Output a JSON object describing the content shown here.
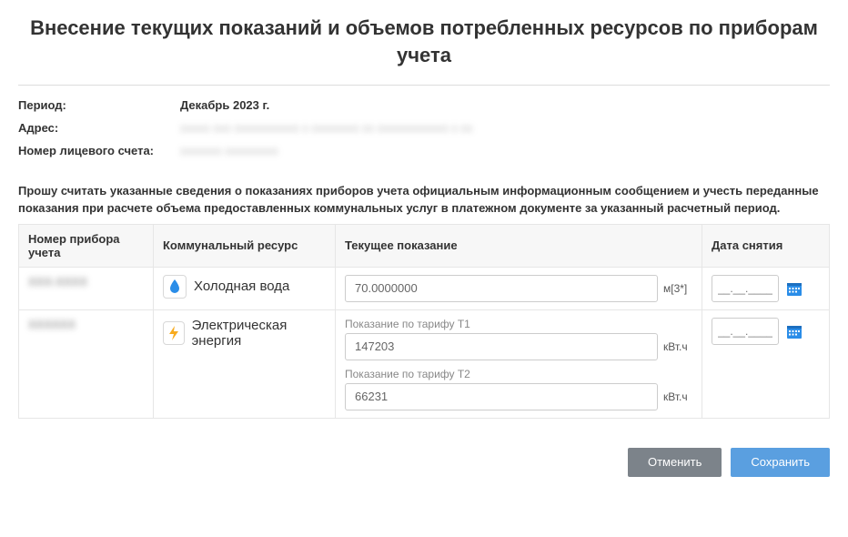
{
  "title": "Внесение текущих показаний и объемов потребленных ресурсов по приборам учета",
  "info": {
    "period_label": "Период:",
    "period_value": "Декабрь 2023 г.",
    "address_label": "Адрес:",
    "address_value": "xxxxx xxx xxxxxxxxxxx x xxxxxxxx xx xxxxxxxxxxxx x xx",
    "account_label": "Номер лицевого счета:",
    "account_value": "xxxxxxx xxxxxxxxx"
  },
  "notice": "Прошу считать указанные сведения о показаниях приборов учета официальным информационным сообщением и учесть переданные показания при расчете объема предоставленных коммунальных услуг в платежном документе за указанный расчетный период.",
  "table": {
    "headers": {
      "meter": "Номер прибора учета",
      "resource": "Коммунальный ресурс",
      "reading": "Текущее показание",
      "date": "Дата снятия"
    },
    "rows": [
      {
        "meter_num": "XXX-XXXX",
        "resource": "Холодная вода",
        "icon": "water-drop-icon",
        "readings": [
          {
            "label": "",
            "value": "70.0000000",
            "unit": "м[3*]"
          }
        ],
        "date_placeholder": "__.__.____"
      },
      {
        "meter_num": "XXXXXX",
        "resource": "Электрическая энергия",
        "icon": "lightning-icon",
        "readings": [
          {
            "label": "Показание по тарифу T1",
            "value": "147203",
            "unit": "кВт.ч"
          },
          {
            "label": "Показание по тарифу T2",
            "value": "66231",
            "unit": "кВт.ч"
          }
        ],
        "date_placeholder": "__.__.____"
      }
    ]
  },
  "buttons": {
    "cancel": "Отменить",
    "save": "Сохранить"
  }
}
